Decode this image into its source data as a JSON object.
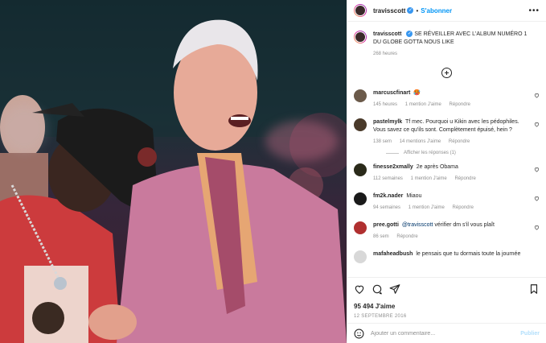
{
  "header": {
    "username": "travisscott",
    "separator": "•",
    "follow_label": "S'abonner",
    "more_icon": "more-horizontal-icon"
  },
  "caption": {
    "username": "travisscott",
    "text": "SE RÉVEILLER AVEC L'ALBUM NUMÉRO 1 DU GLOBE GOTTA NOUS LIKE",
    "time": "268 heures"
  },
  "comments": [
    {
      "username": "marcuscfinart",
      "text": "🥵",
      "time": "145 heures",
      "likes": "1 mention J'aime",
      "reply": "Répondre",
      "avatar_color": "#6b5a4a"
    },
    {
      "username": "pastelmylk",
      "text": "Tf mec. Pourquoi u Kikin avec les pédophiles. Vous savez ce qu'ils sont. Complètement épuisé, hein ?",
      "time": "138 sem",
      "likes": "14 mentions J'aime",
      "reply": "Répondre",
      "avatar_color": "#4a3a2a"
    },
    {
      "username": "finesse2xmally",
      "text": "2e après Obama",
      "time": "112 semaines",
      "likes": "1 mention J'aime",
      "reply": "Répondre",
      "avatar_color": "#2a2a1a"
    },
    {
      "username": "fm2k.nader",
      "text": "Miaou",
      "time": "94 semaines",
      "likes": "1 mention J'aime",
      "reply": "Répondre",
      "avatar_color": "#1a1a1a"
    },
    {
      "username": "pree.gotti",
      "mention": "@travisscott",
      "text": "vérifier dm s'il vous plaît",
      "time": "86 sem",
      "reply": "Répondre",
      "avatar_color": "#b03030"
    },
    {
      "username": "mafaheadbush",
      "text": "le pensais que tu dormais toute la journée",
      "avatar_color": "#d8d8d8"
    }
  ],
  "view_replies": "Afficher les réponses (1)",
  "likes": "95 494 J'aime",
  "date": "12 SEPTEMBRE 2016",
  "composer": {
    "placeholder": "Ajouter un commentaire...",
    "publish_label": "Publier"
  },
  "colors": {
    "accent": "#0095f6",
    "verified": "#3897f0",
    "muted": "#8e8e8e"
  }
}
